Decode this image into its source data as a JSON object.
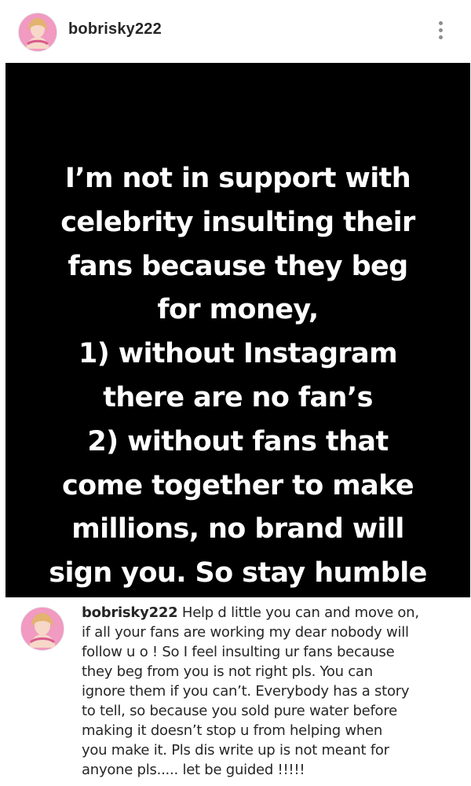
{
  "header": {
    "username": "bobrisky222",
    "avatar_icon": "profile-avatar-icon",
    "menu_icon": "more-vertical-icon"
  },
  "post": {
    "text": "I’m not in support with\ncelebrity insulting their\nfans because they beg\nfor money,\n1) without Instagram\nthere are no fan’s\n2) without fans that\ncome together to make\nmillions, no brand will\nsign you. So stay humble"
  },
  "caption": {
    "username": "bobrisky222",
    "text": " Help d little you can and move on,\nif all your fans are working my dear nobody will\nfollow u o ! So I feel insulting ur fans because\nthey beg from you is not right pls. You can\nignore them if you can’t. Everybody has a story\nto tell, so because you sold pure water before\nmaking it doesn’t stop u from helping when\nyou make it. Pls dis write up is not meant for\nanyone pls..... let be guided !!!!!"
  },
  "colors": {
    "post_background": "#000000",
    "text_primary": "#262626",
    "menu_icon": "#8e8e8e"
  }
}
